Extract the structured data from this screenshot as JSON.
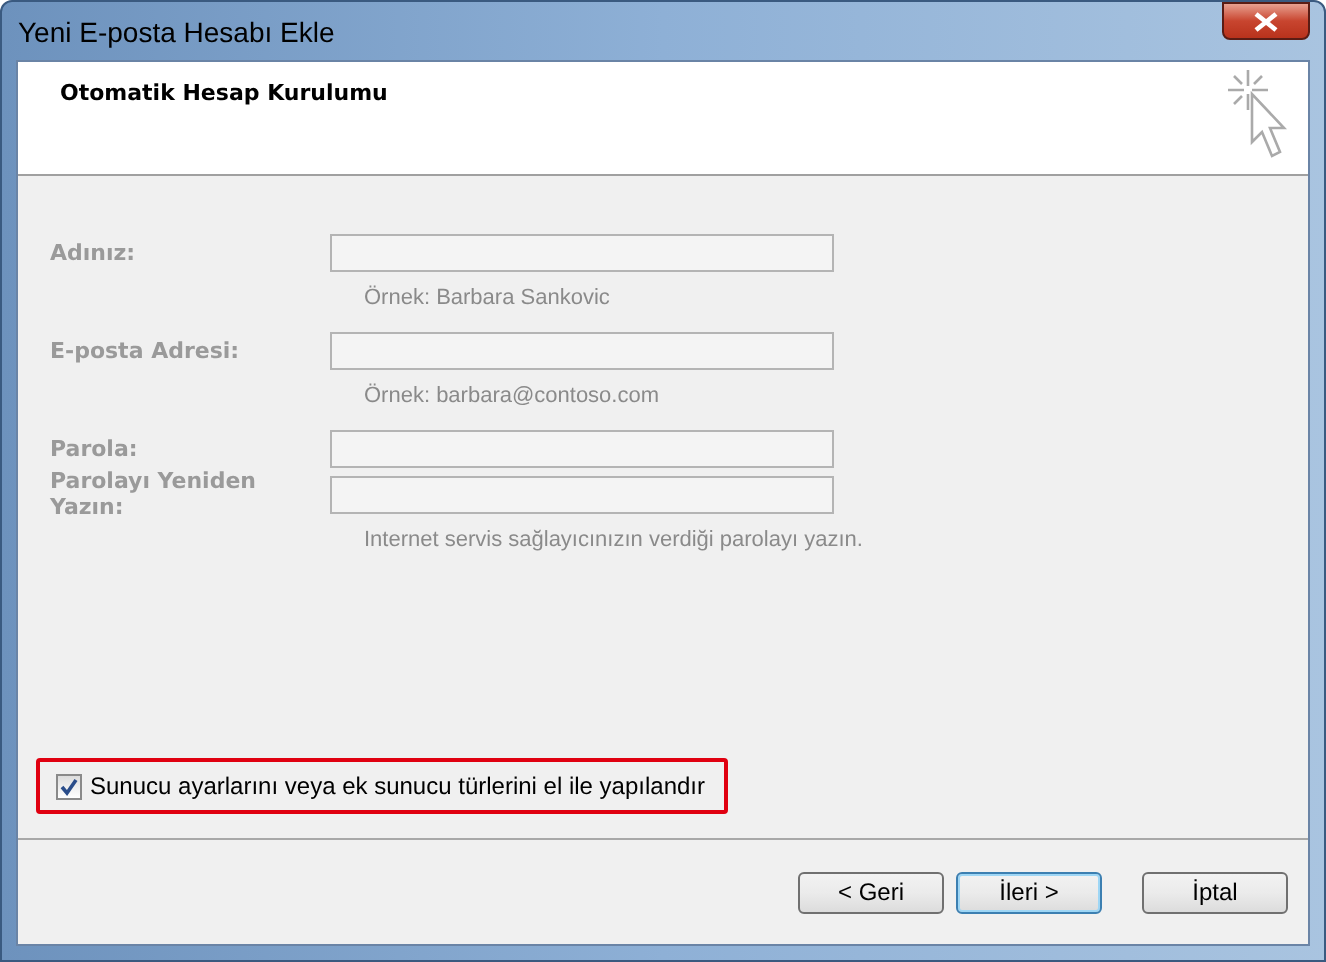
{
  "window": {
    "title": "Yeni E-posta Hesabı Ekle"
  },
  "header": {
    "title": "Otomatik Hesap Kurulumu"
  },
  "fields": [
    {
      "label": "Adınız:",
      "disabled": true,
      "hint": "Örnek: Barbara Sankovic"
    },
    {
      "label": "E-posta Adresi:",
      "disabled": true,
      "hint": "Örnek: barbara@contoso.com"
    },
    {
      "label": "Parola:",
      "disabled": true
    },
    {
      "label": "Parolayı Yeniden Yazın:",
      "disabled": true,
      "hint": "Internet servis sağlayıcınızın verdiği parolayı yazın."
    }
  ],
  "manual_option": {
    "label": "Sunucu ayarlarını veya ek sunucu türlerini el ile yapılandır",
    "checked": true,
    "highlighted": true
  },
  "buttons": [
    {
      "label": "< Geri",
      "default": false
    },
    {
      "label": "İleri >",
      "default": true
    },
    {
      "label": "İptal",
      "default": false
    }
  ]
}
